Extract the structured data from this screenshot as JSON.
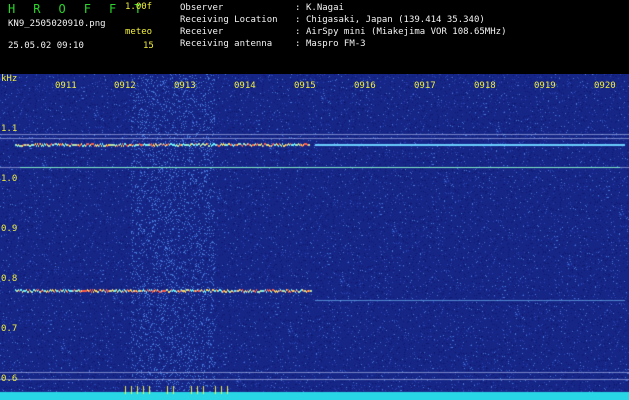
{
  "header": {
    "logo": "H R O F F T",
    "version": "1.00f",
    "filename": "KN9_2505020910.png",
    "meteo_label": "meteo",
    "datetime": "25.05.02 09:10",
    "count": "15",
    "fields": [
      {
        "label": "Observer",
        "value": "K.Nagai"
      },
      {
        "label": "Receiving Location",
        "value": "Chigasaki, Japan (139.414 35.340)"
      },
      {
        "label": "Receiver",
        "value": "AirSpy mini (Miakejima VOR 108.65MHz)"
      },
      {
        "label": "Receiving antenna",
        "value": "Maspro FM-3"
      }
    ]
  },
  "axes": {
    "y_unit": "kHz",
    "y_ticks": [
      "1.1",
      "1.0",
      "0.9",
      "0.8",
      "0.7",
      "0.6"
    ],
    "x_ticks": [
      "0911",
      "0912",
      "0913",
      "0914",
      "0915",
      "0916",
      "0917",
      "0918",
      "0919",
      "0920"
    ]
  },
  "colors": {
    "background": "#1c2f8c",
    "header_green": "#2cd62c",
    "header_yellow": "#f2ef3a",
    "ticks": "#f2ef3a"
  }
}
